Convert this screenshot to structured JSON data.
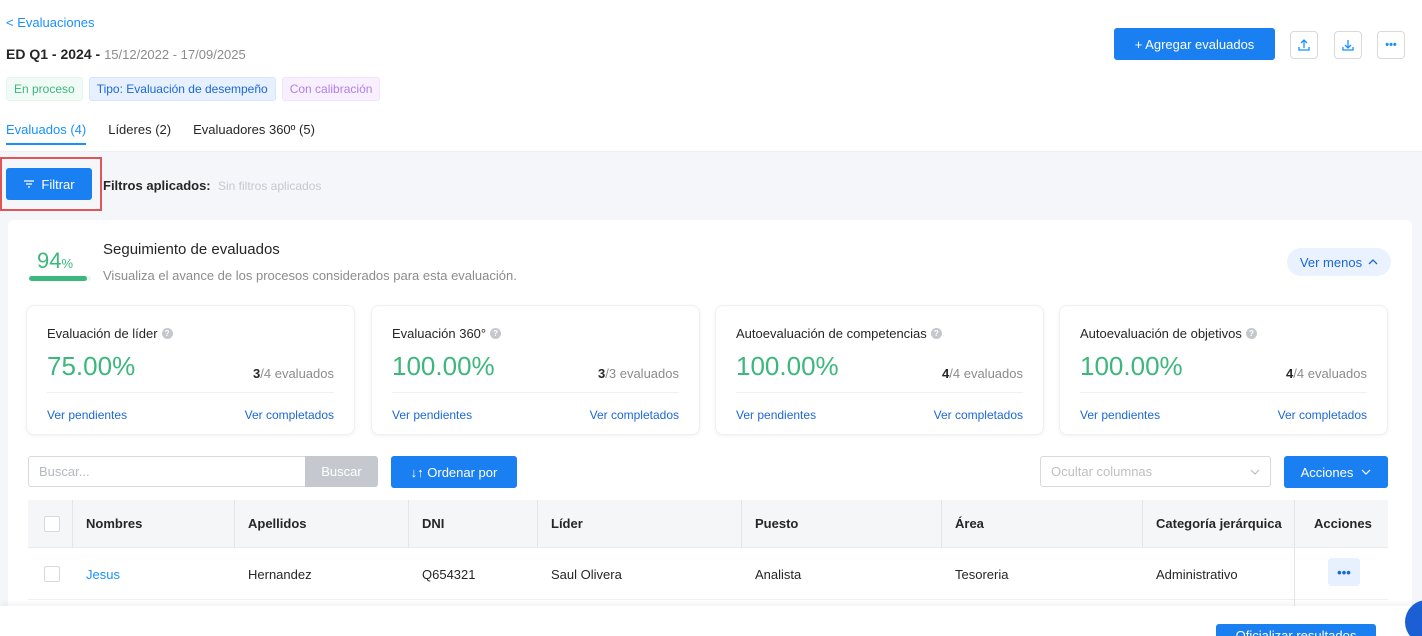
{
  "breadcrumb": {
    "back_label": "< Evaluaciones"
  },
  "evaluation": {
    "name": "ED Q1 - 2024",
    "separator": " - ",
    "dates": "15/12/2022 - 17/09/2025",
    "tags": [
      {
        "label": "En proceso",
        "color": "#3cb77d"
      },
      {
        "label": "Tipo: Evaluación de desempeño",
        "color": "#1c67d6"
      },
      {
        "label": "Con calibración",
        "color": "#b37feb"
      }
    ]
  },
  "header_actions": {
    "add_label": "+ Agregar evaluados",
    "upload_icon": "upload-icon",
    "download_icon": "download-icon",
    "more_label": "•••"
  },
  "tabs": [
    {
      "label": "Evaluados (4)",
      "active": true
    },
    {
      "label": "Líderes (2)",
      "active": false
    },
    {
      "label": "Evaluadores 360º (5)",
      "active": false
    }
  ],
  "filters": {
    "button_label": "Filtrar",
    "applied_label": "Filtros aplicados:",
    "applied_value": "Sin filtros aplicados"
  },
  "tracking": {
    "percent": "94",
    "percent_sign": "%",
    "progress": 0.94,
    "title": "Seguimiento de evaluados",
    "subtitle": "Visualiza el avance de los procesos considerados para esta evaluación.",
    "toggle_label": "Ver menos"
  },
  "stats": [
    {
      "title": "Evaluación de líder",
      "percent": "75.00%",
      "done": "3",
      "total": "/4 evaluados",
      "pending_label": "Ver pendientes",
      "completed_label": "Ver completados"
    },
    {
      "title": "Evaluación 360°",
      "percent": "100.00%",
      "done": "3",
      "total": "/3 evaluados",
      "pending_label": "Ver pendientes",
      "completed_label": "Ver completados"
    },
    {
      "title": "Autoevaluación de competencias",
      "percent": "100.00%",
      "done": "4",
      "total": "/4 evaluados",
      "pending_label": "Ver pendientes",
      "completed_label": "Ver completados"
    },
    {
      "title": "Autoevaluación de objetivos",
      "percent": "100.00%",
      "done": "4",
      "total": "/4 evaluados",
      "pending_label": "Ver pendientes",
      "completed_label": "Ver completados"
    }
  ],
  "toolbar": {
    "search_placeholder": "Buscar...",
    "search_button": "Buscar",
    "sort_label": "↓↑ Ordenar por",
    "hide_columns_placeholder": "Ocultar columnas",
    "actions_label": "Acciones"
  },
  "table": {
    "columns": [
      "Nombres",
      "Apellidos",
      "DNI",
      "Líder",
      "Puesto",
      "Área",
      "Categoría jerárquica",
      "Acciones"
    ],
    "rows": [
      {
        "nombres": "Jesus",
        "apellidos": "Hernandez",
        "dni": "Q654321",
        "lider": "Saul Olivera",
        "puesto": "Analista",
        "area": "Tesoreria",
        "categoria": "Administrativo",
        "action": "•••"
      }
    ]
  },
  "footer": {
    "button_label": "Oficializar resultados"
  },
  "colors": {
    "primary": "#1a7ff0",
    "success": "#3cb77d",
    "highlight": "#e05656"
  }
}
